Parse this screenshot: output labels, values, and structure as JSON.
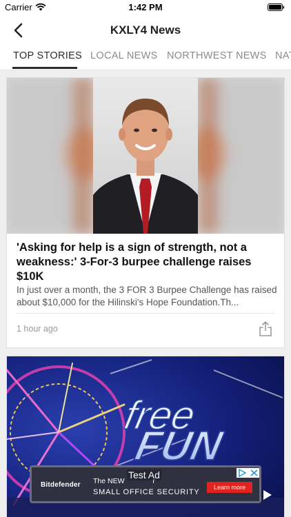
{
  "status_bar": {
    "carrier": "Carrier",
    "time": "1:42 PM"
  },
  "nav": {
    "title": "KXLY4 News",
    "back_icon": "chevron-left-icon"
  },
  "tabs": [
    {
      "label": "TOP STORIES",
      "active": true
    },
    {
      "label": "LOCAL NEWS",
      "active": false
    },
    {
      "label": "NORTHWEST NEWS",
      "active": false
    },
    {
      "label": "NAT",
      "active": false
    }
  ],
  "articles": [
    {
      "headline": "'Asking for help is a sign of strength, not a weakness:' 3-For-3 burpee challenge raises $10K",
      "summary": "In just over a month, the 3 FOR 3 Burpee Challenge has raised about $10,000 for the Hilinski's Hope Foundation.Th...",
      "timestamp": "1 hour ago",
      "share_icon": "share-icon"
    },
    {
      "image_text_1": "free",
      "image_text_2": "FUN"
    }
  ],
  "ad": {
    "label": "Test Ad",
    "brand": "Bitdefender",
    "line1": "The NEW",
    "line1_suffix": "r",
    "line2": "SMALL OFFICE SECURITY",
    "cta": "Learn more"
  },
  "colors": {
    "tab_active": "#2b2b2b",
    "tab_inactive": "#8b8b8b",
    "ad_cta": "#e0231f",
    "background": "#efeff0"
  }
}
